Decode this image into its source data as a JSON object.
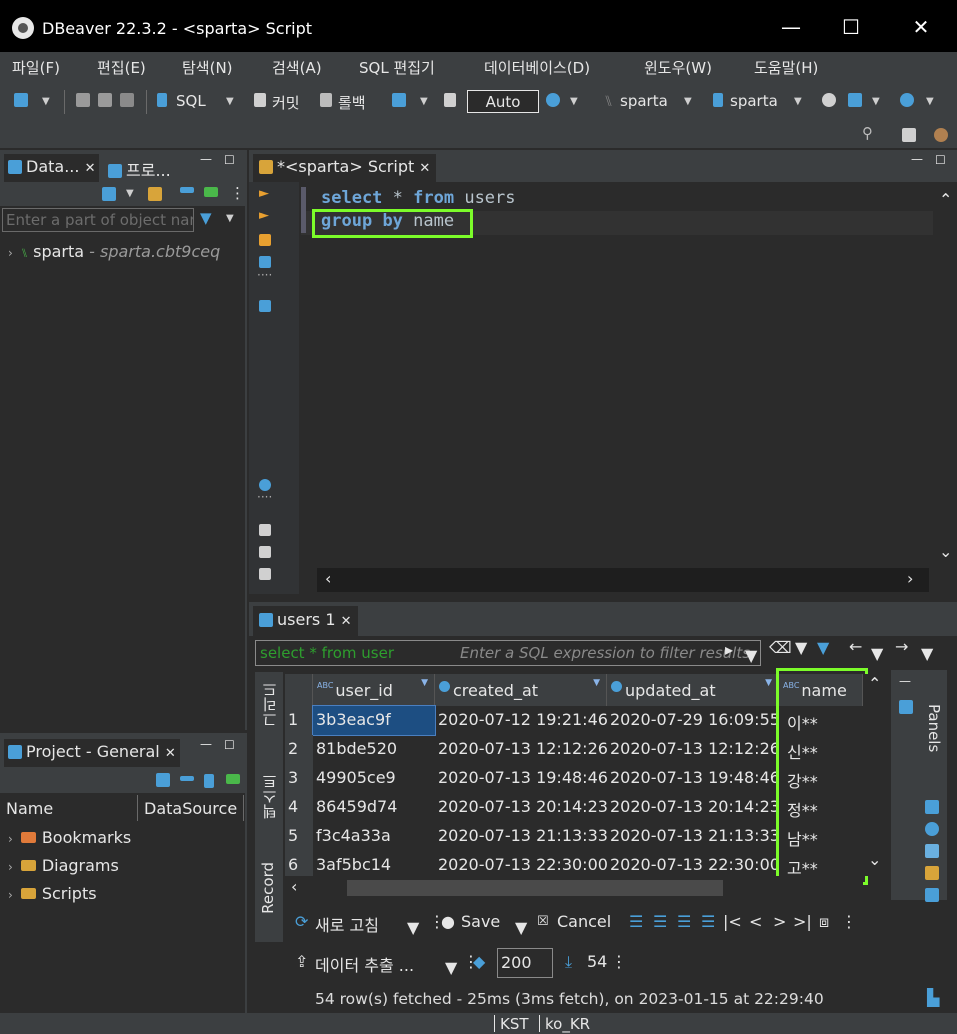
{
  "window": {
    "title": "DBeaver 22.3.2 - <sparta> Script",
    "minimize": "—",
    "maximize": "☐",
    "close": "✕"
  },
  "menu": {
    "items": [
      "파일(F)",
      "편집(E)",
      "탐색(N)",
      "검색(A)",
      "SQL 편집기",
      "데이터베이스(D)",
      "윈도우(W)",
      "도움말(H)"
    ]
  },
  "toolbar": {
    "sql_label": "SQL",
    "commit_label": "커밋",
    "rollback_label": "롤백",
    "auto_label": "Auto",
    "datasource_label": "sparta",
    "schema_label": "sparta"
  },
  "navigator": {
    "tab_label": "Data...",
    "projects_tab_label": "프로...",
    "filter_placeholder": "Enter a part of object name",
    "connection_name": "sparta",
    "connection_detail": "- sparta.cbt9ceq"
  },
  "project_panel": {
    "tab_label": "Project - General",
    "columns": [
      "Name",
      "DataSource"
    ],
    "items": [
      "Bookmarks",
      "Diagrams",
      "Scripts"
    ]
  },
  "editor": {
    "tab_label": "*<sparta> Script",
    "lines": [
      {
        "kw1": "select",
        "rest1": " * ",
        "kw2": "from",
        "rest2": " users"
      },
      {
        "kw1": "group",
        "rest1": " ",
        "kw2": "by",
        "rest2": " name"
      }
    ]
  },
  "results": {
    "tab_label": "users 1",
    "filter_query": "select * from user",
    "filter_placeholder": "Enter a SQL expression to filter results",
    "side_tabs": [
      "그리드",
      "텍스트",
      "Record"
    ],
    "panels_label": "Panels",
    "columns": [
      "user_id",
      "created_at",
      "updated_at",
      "name"
    ],
    "rows": [
      {
        "num": "1",
        "user_id": "3b3eac9f",
        "created_at": "2020-07-12 19:21:46",
        "updated_at": "2020-07-29 16:09:55",
        "name": "이**"
      },
      {
        "num": "2",
        "user_id": "81bde520",
        "created_at": "2020-07-13 12:12:26",
        "updated_at": "2020-07-13 12:12:26",
        "name": "신**"
      },
      {
        "num": "3",
        "user_id": "49905ce9",
        "created_at": "2020-07-13 19:48:46",
        "updated_at": "2020-07-13 19:48:46",
        "name": "강**"
      },
      {
        "num": "4",
        "user_id": "86459d74",
        "created_at": "2020-07-13 20:14:23",
        "updated_at": "2020-07-13 20:14:23",
        "name": "정**"
      },
      {
        "num": "5",
        "user_id": "f3c4a33a",
        "created_at": "2020-07-13 21:13:33",
        "updated_at": "2020-07-13 21:13:33",
        "name": "남**"
      },
      {
        "num": "6",
        "user_id": "3af5bc14",
        "created_at": "2020-07-13 22:30:00",
        "updated_at": "2020-07-13 22:30:00",
        "name": "고**"
      }
    ],
    "refresh_label": "새로 고침",
    "save_label": "Save",
    "cancel_label": "Cancel",
    "export_label": "데이터 추출 ...",
    "fetch_size": "200",
    "row_count": "54",
    "status": "54 row(s) fetched - 25ms (3ms fetch), on 2023-01-15 at 22:29:40"
  },
  "statusbar": {
    "timezone": "KST",
    "locale": "ko_KR"
  },
  "colors": {
    "highlight": "#7cfc2a",
    "keyword": "#6ea6d8",
    "background": "#2b2b2b"
  }
}
